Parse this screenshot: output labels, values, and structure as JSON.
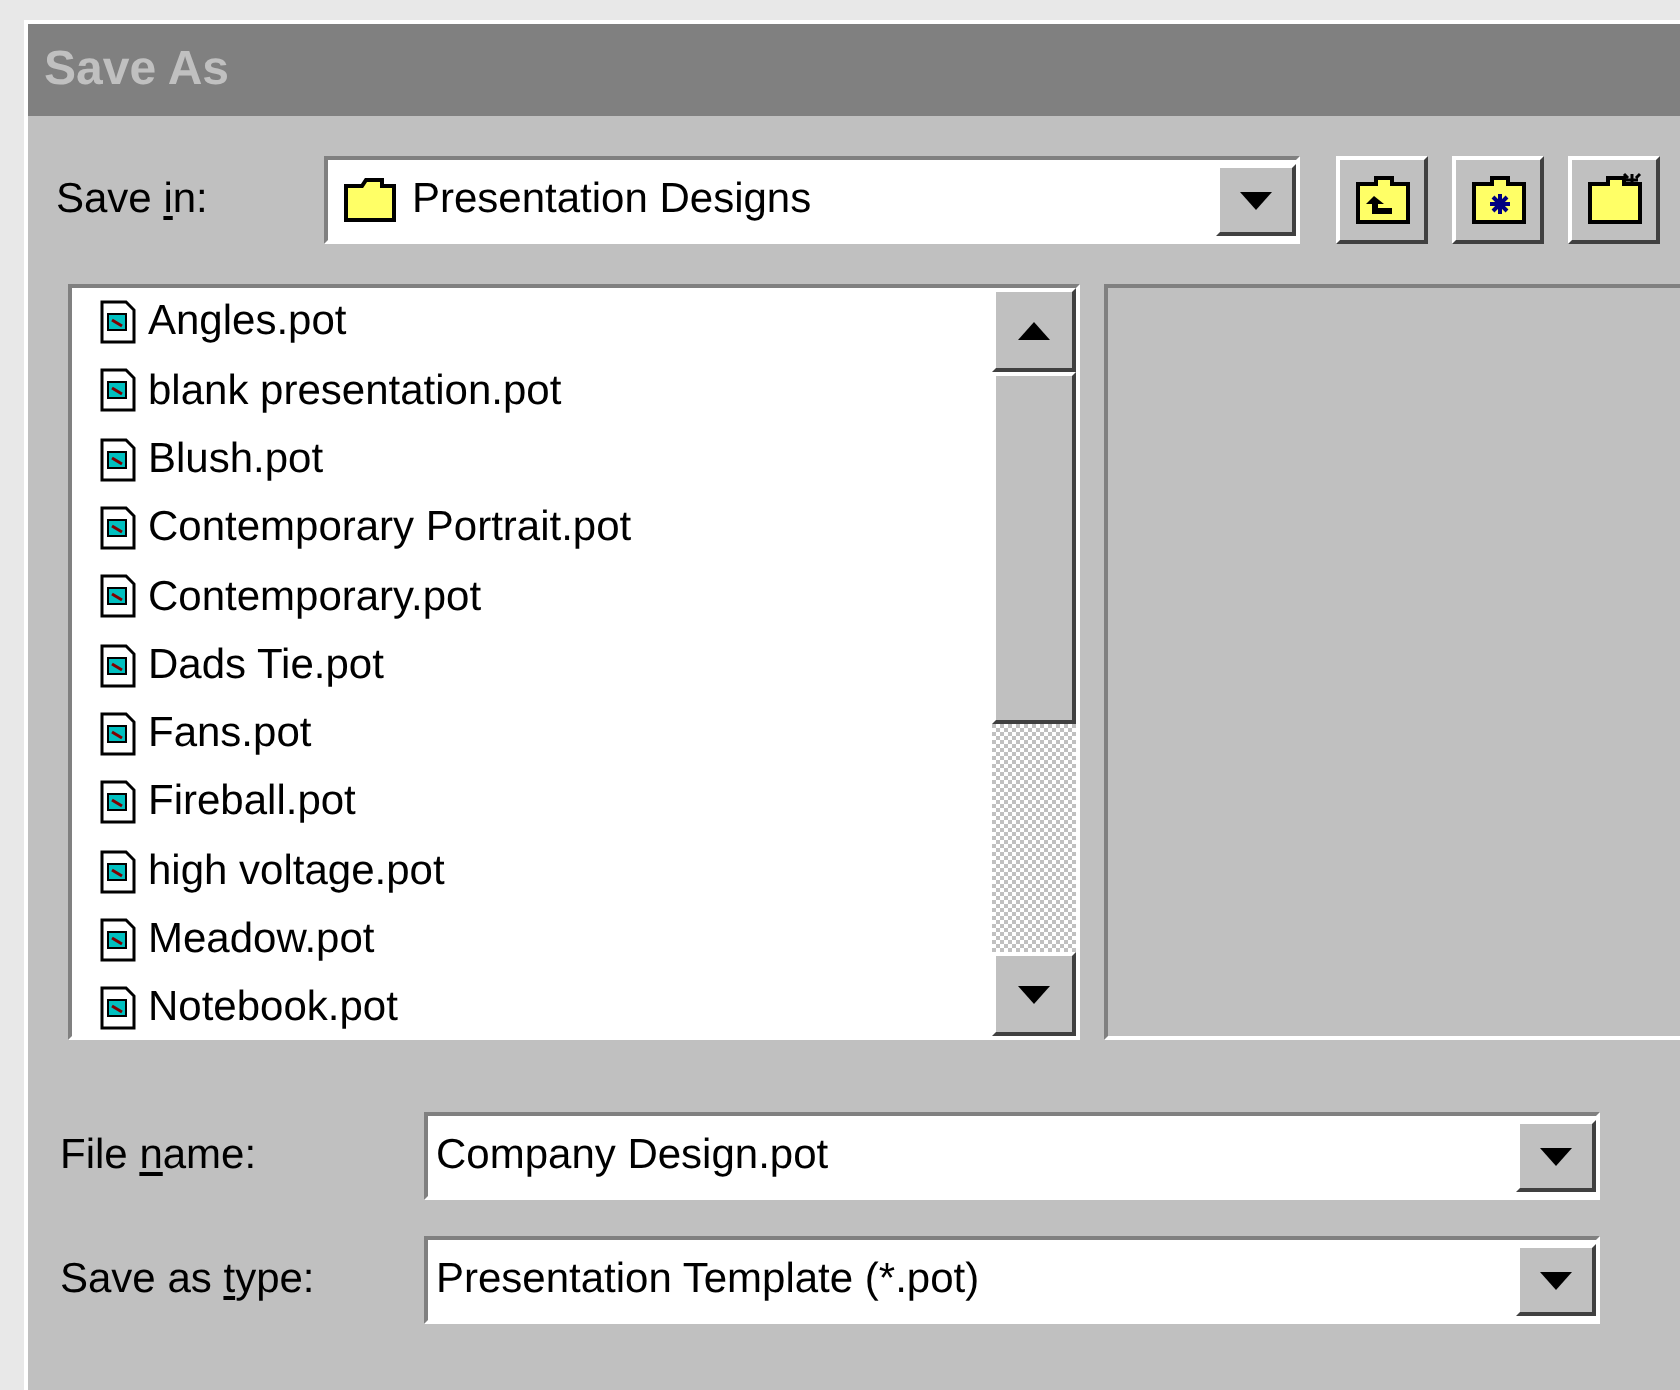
{
  "window": {
    "title": "Save As"
  },
  "save_in": {
    "label": {
      "before": "Save ",
      "key": "i",
      "after": "n:"
    },
    "value": "Presentation Designs"
  },
  "toolbar": [
    {
      "kind": "up"
    },
    {
      "kind": "new"
    },
    {
      "kind": "sparkle"
    }
  ],
  "files": [
    {
      "name": "Angles.pot"
    },
    {
      "name": "blank presentation.pot"
    },
    {
      "name": "Blush.pot"
    },
    {
      "name": "Contemporary Portrait.pot"
    },
    {
      "name": "Contemporary.pot"
    },
    {
      "name": "Dads Tie.pot"
    },
    {
      "name": "Fans.pot"
    },
    {
      "name": "Fireball.pot"
    },
    {
      "name": "high voltage.pot"
    },
    {
      "name": "Meadow.pot"
    },
    {
      "name": "Notebook.pot"
    }
  ],
  "file_name": {
    "label": {
      "before": "File ",
      "key": "n",
      "after": "ame:"
    },
    "value": "Company Design.pot"
  },
  "save_as_type": {
    "label": {
      "before": "Save as ",
      "key": "t",
      "after": "ype:"
    },
    "value": "Presentation Template (*.pot)"
  }
}
